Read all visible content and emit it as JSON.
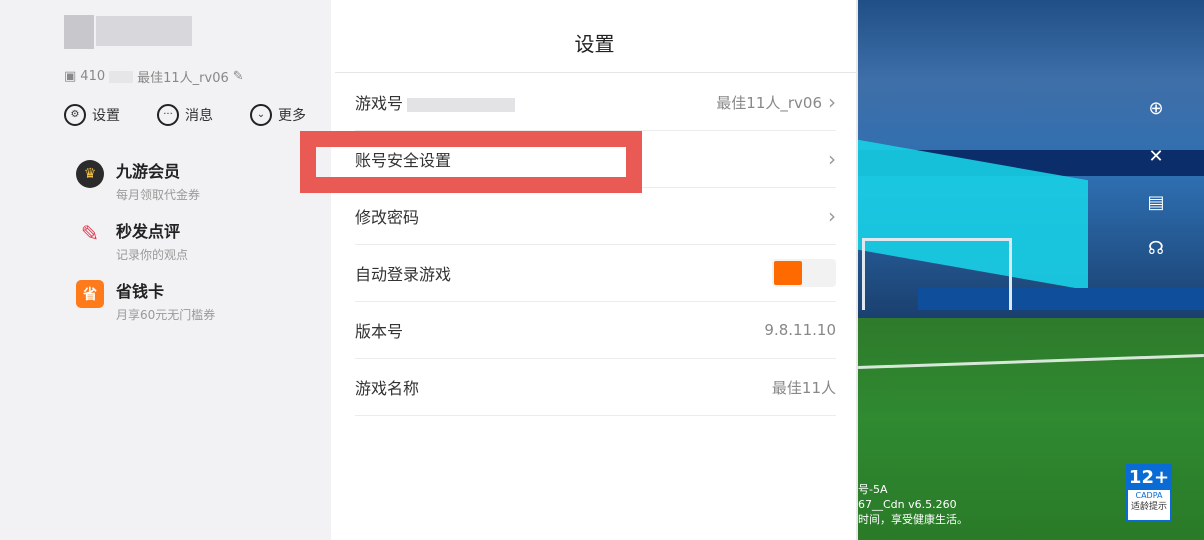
{
  "left": {
    "uid_prefix": "410",
    "username_partial": "最佳11人_rv06",
    "quick_actions": [
      {
        "label": "设置",
        "icon": "settings-icon"
      },
      {
        "label": "消息",
        "icon": "message-icon"
      },
      {
        "label": "更多",
        "icon": "more-icon"
      }
    ],
    "menu": [
      {
        "title": "九游会员",
        "subtitle": "每月领取代金券",
        "icon": "crown-icon",
        "color": "#2b2b2b",
        "glyph": "♛"
      },
      {
        "title": "秒发点评",
        "subtitle": "记录你的观点",
        "icon": "pencil-icon",
        "color": "#ffffff",
        "glyph": "✎"
      },
      {
        "title": "省钱卡",
        "subtitle": "月享60元无门槛券",
        "icon": "card-icon",
        "color": "#ff7a1a",
        "glyph": "省"
      }
    ]
  },
  "settings": {
    "title": "设置",
    "rows": [
      {
        "label": "游戏号",
        "value": "最佳11人_rv06"
      },
      {
        "label": "账号安全设置",
        "value": ""
      },
      {
        "label": "修改密码",
        "value": ""
      },
      {
        "label": "自动登录游戏",
        "value": ""
      },
      {
        "label": "版本号",
        "value": "9.8.11.10"
      },
      {
        "label": "游戏名称",
        "value": "最佳11人"
      }
    ],
    "highlight_color": "#ea5a55",
    "toggle_color": "#ff6a00"
  },
  "game": {
    "version_lines": [
      "号-5A",
      "67__Cdn v6.5.260",
      "时间，享受健康生活。"
    ],
    "age_rating": {
      "big": "12+",
      "org": "CADPA",
      "tip": "适龄提示"
    }
  }
}
